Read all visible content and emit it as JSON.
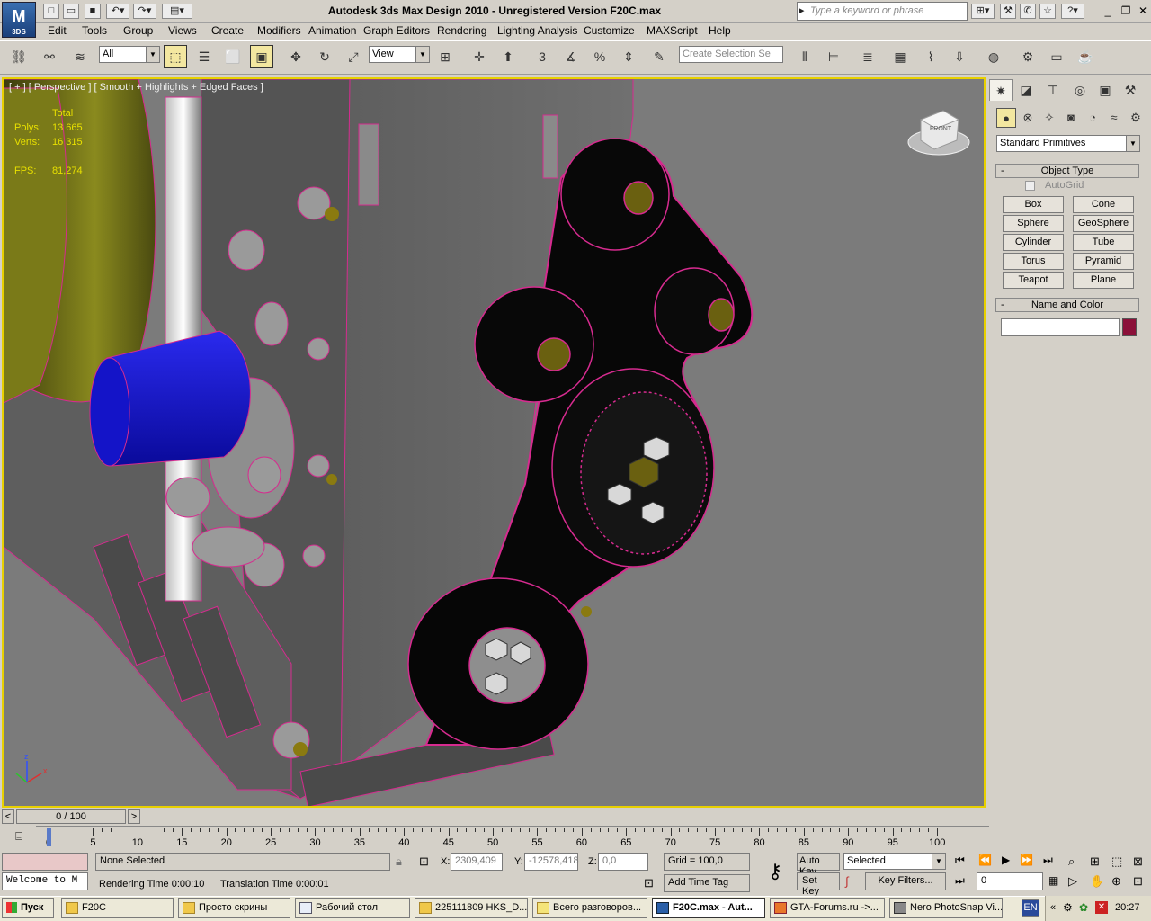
{
  "app": {
    "logo_text": "3DS",
    "title": "Autodesk 3ds Max Design 2010  - Unregistered Version     F20C.max",
    "search_placeholder": "Type a keyword or phrase"
  },
  "menu": [
    "Edit",
    "Tools",
    "Group",
    "Views",
    "Create",
    "Modifiers",
    "Animation",
    "Graph Editors",
    "Rendering",
    "Lighting Analysis",
    "Customize",
    "MAXScript",
    "Help"
  ],
  "toolbar": {
    "selection_filter": "All",
    "ref_coord": "View",
    "named_selection_placeholder": "Create Selection Se",
    "snap_angle": "3",
    "percent_snap": "%"
  },
  "viewport": {
    "label": "[ + ] [ Perspective ] [ Smooth + Highlights + Edged Faces ]",
    "stats": {
      "header": "Total",
      "polys_label": "Polys:",
      "polys_value": "13 665",
      "verts_label": "Verts:",
      "verts_value": "16 315",
      "fps_label": "FPS:",
      "fps_value": "81,274"
    },
    "axes": {
      "z": "z",
      "x": "x"
    },
    "viewcube_label": "FRONT"
  },
  "command_panel": {
    "category": "Standard Primitives",
    "object_type_title": "Object Type",
    "autogrid_label": "AutoGrid",
    "buttons": [
      "Box",
      "Cone",
      "Sphere",
      "GeoSphere",
      "Cylinder",
      "Tube",
      "Torus",
      "Pyramid",
      "Teapot",
      "Plane"
    ],
    "name_color_title": "Name and Color",
    "name_value": "",
    "object_color": "#8b1039"
  },
  "timeline": {
    "frame_display": "0 / 100",
    "prev_label": "<",
    "next_label": ">",
    "tick_labels": [
      "0",
      "5",
      "10",
      "15",
      "20",
      "25",
      "30",
      "35",
      "40",
      "45",
      "50",
      "55",
      "60",
      "65",
      "70",
      "75",
      "80",
      "85",
      "90",
      "95",
      "100"
    ]
  },
  "status": {
    "selection": "None Selected",
    "rendering_time_label": "Rendering Time  0:00:10",
    "translation_time_label": "Translation Time  0:00:01",
    "maxscript_listener": "Welcome to M",
    "x_label": "X:",
    "x_value": "2309,409",
    "y_label": "Y:",
    "y_value": "-12578,418",
    "z_label": "Z:",
    "z_value": "0,0",
    "grid": "Grid = 100,0",
    "add_time_tag": "Add Time Tag",
    "auto_key": "Auto Key",
    "set_key": "Set Key",
    "key_mode": "Selected",
    "key_filters": "Key Filters...",
    "current_frame": "0"
  },
  "taskbar": {
    "start_label": "Пуск",
    "tasks": [
      "F20C",
      "Просто скрины",
      "Рабочий стол",
      "225111809 HKS_D...",
      "Всего разговоров...",
      "F20C.max - Aut...",
      "GTA-Forums.ru ->...",
      "Nero PhotoSnap Vi..."
    ],
    "active_index": 5,
    "language": "EN",
    "clock": "20:27"
  }
}
